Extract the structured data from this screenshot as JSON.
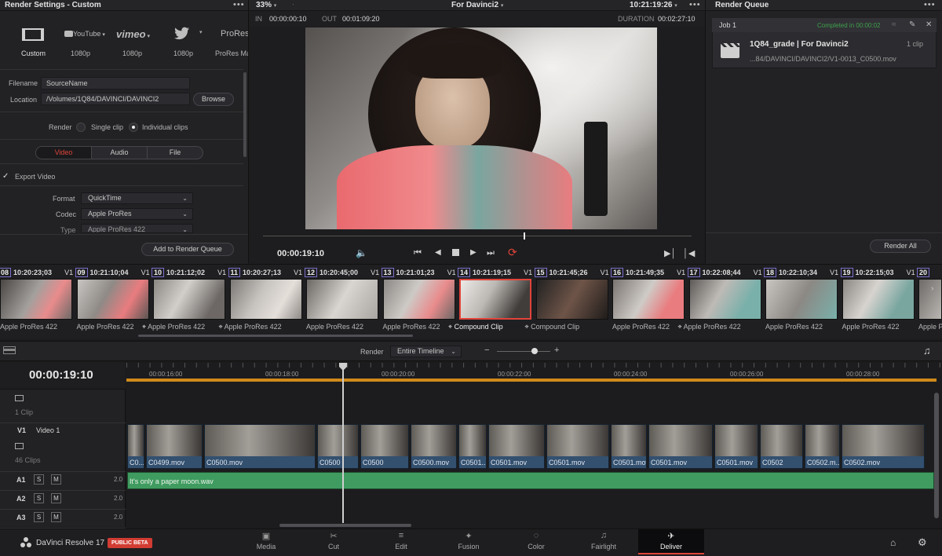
{
  "render_settings": {
    "title": "Render Settings - Custom",
    "presets": [
      {
        "icon": "film-icon",
        "name": "",
        "label": "Custom"
      },
      {
        "icon": "youtube-icon",
        "name": "YouTube",
        "label": "1080p"
      },
      {
        "icon": "vimeo-icon",
        "name": "vimeo",
        "label": "1080p"
      },
      {
        "icon": "twitter-icon",
        "name": "",
        "label": "1080p"
      },
      {
        "icon": "prores-icon",
        "name": "ProRes",
        "label": "ProRes Mas"
      }
    ],
    "filename_label": "Filename",
    "filename_value": "SourceName",
    "location_label": "Location",
    "location_value": "/Volumes/1Q84/DAVINCI/DAVINCI2",
    "browse_label": "Browse",
    "render_label": "Render",
    "single_clip_label": "Single clip",
    "individual_clips_label": "Individual clips",
    "tabs": [
      "Video",
      "Audio",
      "File"
    ],
    "export_video_label": "Export Video",
    "format_label": "Format",
    "format_value": "QuickTime",
    "codec_label": "Codec",
    "codec_value": "Apple ProRes",
    "type_label": "Type",
    "type_value": "Apple ProRes 422",
    "add_to_queue_label": "Add to Render Queue"
  },
  "viewer": {
    "zoom": "33%",
    "timeline_name": "For Davinci2",
    "timecode_top": "10:21:19:26",
    "in_label": "IN",
    "in_value": "00:00:00:10",
    "out_label": "OUT",
    "out_value": "00:01:09:20",
    "duration_label": "DURATION",
    "duration_value": "00:02:27:10",
    "current_tc": "00:00:19:10"
  },
  "render_queue": {
    "title": "Render Queue",
    "job_label": "Job 1",
    "status": "Completed in 00:00:02",
    "job_name": "1Q84_grade | For Davinci2",
    "clip_count": "1 clip",
    "path": "...84/DAVINCI/DAVINCI2/V1-0013_C0500.mov",
    "render_all_label": "Render All"
  },
  "clips": [
    {
      "num": "08",
      "tc": "10:20:23;03",
      "track": "V1",
      "cap": "Apple ProRes 422",
      "compound": false
    },
    {
      "num": "09",
      "tc": "10:21:10;04",
      "track": "V1",
      "cap": "Apple ProRes 422",
      "compound": false
    },
    {
      "num": "10",
      "tc": "10:21:12;02",
      "track": "V1",
      "cap": "Apple ProRes 422",
      "compound": true
    },
    {
      "num": "11",
      "tc": "10:20:27;13",
      "track": "V1",
      "cap": "Apple ProRes 422",
      "compound": true
    },
    {
      "num": "12",
      "tc": "10:20:45;00",
      "track": "V1",
      "cap": "Apple ProRes 422",
      "compound": false
    },
    {
      "num": "13",
      "tc": "10:21:01;23",
      "track": "V1",
      "cap": "Apple ProRes 422",
      "compound": false
    },
    {
      "num": "14",
      "tc": "10:21:19;15",
      "track": "V1",
      "cap": "Compound Clip",
      "compound": true
    },
    {
      "num": "15",
      "tc": "10:21:45;26",
      "track": "V1",
      "cap": "Compound Clip",
      "compound": true
    },
    {
      "num": "16",
      "tc": "10:21:49;35",
      "track": "V1",
      "cap": "Apple ProRes 422",
      "compound": false
    },
    {
      "num": "17",
      "tc": "10:22:08;44",
      "track": "V1",
      "cap": "Apple ProRes 422",
      "compound": true
    },
    {
      "num": "18",
      "tc": "10:22:10;34",
      "track": "V1",
      "cap": "Apple ProRes 422",
      "compound": false
    },
    {
      "num": "19",
      "tc": "10:22:15;03",
      "track": "V1",
      "cap": "Apple ProRes 422",
      "compound": false
    },
    {
      "num": "20",
      "tc": "",
      "track": "",
      "cap": "Apple P",
      "compound": false
    }
  ],
  "timeline_toolbar": {
    "render_label": "Render",
    "render_value": "Entire Timeline"
  },
  "timeline": {
    "current_tc": "00:00:19:10",
    "ruler": [
      "00:00:16:00",
      "00:00:18:00",
      "00:00:20:00",
      "00:00:22:00",
      "00:00:24:00",
      "00:00:26:00",
      "00:00:28:00"
    ],
    "v2_clips": "1 Clip",
    "v1_label": "V1",
    "v1_name": "Video 1",
    "v1_clips": "46 Clips",
    "video_clips": [
      "C0...",
      "C0499.mov",
      "C0500.mov",
      "C0500",
      "C0500",
      "C0500.mov",
      "C0501....",
      "C0501.mov",
      "C0501.mov",
      "C0501.mov",
      "C0501.mov",
      "C0501.mov",
      "C0502",
      "C0502.m...",
      "C0502.mov"
    ],
    "audio_tracks": [
      {
        "label": "A1",
        "level": "2.0"
      },
      {
        "label": "A2",
        "level": "2.0"
      },
      {
        "label": "A3",
        "level": "2.0"
      }
    ],
    "solo_label": "S",
    "mute_label": "M",
    "audio_clip_name": "It's only a paper moon.wav"
  },
  "bottom_bar": {
    "app_name": "DaVinci Resolve 17",
    "badge": "PUBLIC BETA",
    "tabs": [
      "Media",
      "Cut",
      "Edit",
      "Fusion",
      "Color",
      "Fairlight",
      "Deliver"
    ],
    "active_tab": "Deliver"
  },
  "colors": {
    "accent": "#e0443a",
    "audio_green": "#3f9b5f",
    "clip_blue": "#33506f",
    "progress_orange": "#d08a1a",
    "completed_green": "#3fa04a"
  }
}
